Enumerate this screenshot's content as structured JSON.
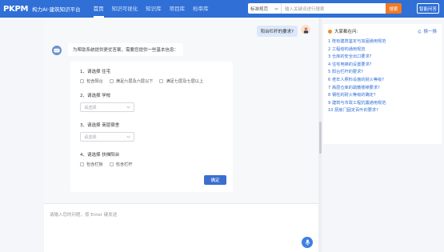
{
  "header": {
    "logo": "PKPM",
    "app_title": "构力AI·建筑知识平台",
    "nav": [
      {
        "label": "首页",
        "active": true
      },
      {
        "label": "知识可视化",
        "active": false
      },
      {
        "label": "知识库",
        "active": false
      },
      {
        "label": "项目库",
        "active": false
      },
      {
        "label": "检审库",
        "active": false
      }
    ],
    "search": {
      "category": "标准规范",
      "placeholder": "输入关键词进行搜索",
      "button": "搜索"
    },
    "smart_qa": "智能问答"
  },
  "chat": {
    "user_message": "阳台栏杆的要求?",
    "bot_intro": "为帮助系统提供更优答案，需要您提供一些基本信息：",
    "questions": [
      {
        "title": "1、请选择 住宅",
        "options": [
          "包含阳台",
          "满足六层及六层以下",
          "满足七层及七层以上"
        ]
      },
      {
        "title": "2、请选择 学校",
        "select_placeholder": "请选择"
      },
      {
        "title": "3、请选择 商层宿舍",
        "select_placeholder": "请选择"
      },
      {
        "title": "4、请选择 扶梯阳台",
        "options": [
          "包含栏板",
          "包含栏杆"
        ]
      }
    ],
    "confirm": "确定",
    "input_placeholder": "请输入您的问题，按 Enter 键发送"
  },
  "panel": {
    "title": "大家都在问:",
    "refresh": "换一换",
    "questions": [
      "1 既有建筑鉴定与加固通用规范",
      "2 工程结构通用规范",
      "3 仓库的安全出口要求?",
      "4 住宅电梯的设置要求?",
      "5 阳台栏杆的要求?",
      "6 老年人照料设施的耐火等级?",
      "7 高层仓库的疏散楼梯要求?",
      "8 钢柱的耐火等级的确定?",
      "9 建筑与市政工程抗震通用规范",
      "10 厨房门固定百叶的要求?"
    ]
  },
  "colors": {
    "header_bg": "#2f6fd6",
    "search_button": "#f07b22",
    "link": "#2f6fd6"
  }
}
